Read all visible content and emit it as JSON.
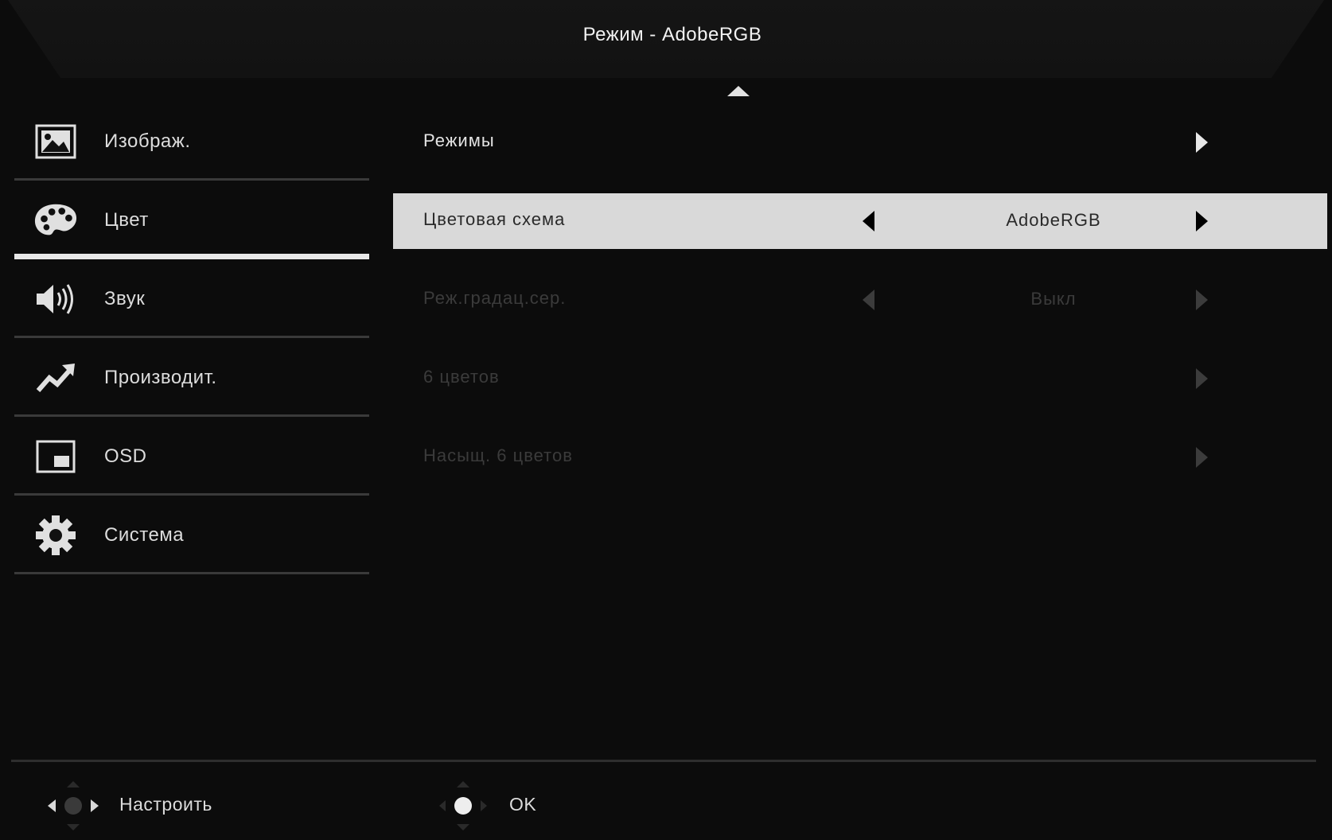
{
  "header": {
    "title": "Режим - AdobeRGB"
  },
  "sidebar": {
    "items": [
      {
        "label": "Изображ.",
        "icon": "image-icon",
        "active": false
      },
      {
        "label": "Цвет",
        "icon": "palette-icon",
        "active": true
      },
      {
        "label": "Звук",
        "icon": "speaker-icon",
        "active": false
      },
      {
        "label": "Производит.",
        "icon": "performance-chart-icon",
        "active": false
      },
      {
        "label": "OSD",
        "icon": "osd-window-icon",
        "active": false
      },
      {
        "label": "Система",
        "icon": "gear-icon",
        "active": false
      }
    ]
  },
  "main": {
    "rows": [
      {
        "label": "Режимы",
        "value": "",
        "state": "normal"
      },
      {
        "label": "Цветовая схема",
        "value": "AdobeRGB",
        "state": "selected"
      },
      {
        "label": "Реж.градац.сер.",
        "value": "Выкл",
        "state": "disabled"
      },
      {
        "label": "6 цветов",
        "value": "",
        "state": "disabled"
      },
      {
        "label": "Насыщ. 6 цветов",
        "value": "",
        "state": "disabled"
      }
    ]
  },
  "footer": {
    "adjust_label": "Настроить",
    "ok_label": "OK"
  },
  "colors": {
    "background": "#0c0c0c",
    "highlight": "#d9d9d9",
    "text": "#dcdcdc",
    "disabled_text": "#3b3b3b",
    "divider": "#3a3a3a"
  }
}
